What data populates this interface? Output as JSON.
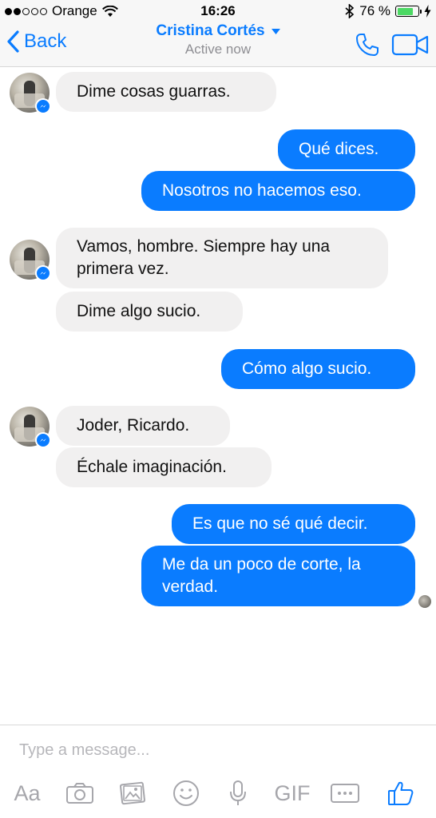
{
  "status_bar": {
    "carrier": "Orange",
    "time": "16:26",
    "battery_percent": "76 %",
    "battery_level": 0.76
  },
  "header": {
    "back_label": "Back",
    "contact_name": "Cristina Cortés",
    "status": "Active now"
  },
  "messages": [
    {
      "side": "in",
      "text": "Dime cosas guarras."
    },
    {
      "side": "out",
      "text": "Qué dices."
    },
    {
      "side": "out",
      "text": "Nosotros no hacemos eso."
    },
    {
      "side": "in",
      "text": "Vamos, hombre. Siempre hay una primera vez."
    },
    {
      "side": "in",
      "text": "Dime algo sucio."
    },
    {
      "side": "out",
      "text": "Cómo algo sucio."
    },
    {
      "side": "in",
      "text": "Joder, Ricardo."
    },
    {
      "side": "in",
      "text": "Échale imaginación."
    },
    {
      "side": "out",
      "text": "Es que no sé qué decir."
    },
    {
      "side": "out",
      "text": "Me da un poco de corte, la verdad."
    }
  ],
  "composer": {
    "placeholder": "Type a message...",
    "tools": {
      "text": "Aa",
      "camera": "camera-icon",
      "gallery": "gallery-icon",
      "emoji": "emoji-icon",
      "mic": "microphone-icon",
      "gif": "GIF",
      "more": "more-icon",
      "like": "thumbs-up-icon"
    }
  },
  "colors": {
    "accent": "#0a7cff",
    "incoming_bubble": "#f1f0f0",
    "outgoing_bubble": "#0a7cff",
    "toolbar_icon": "#a6a6ab"
  }
}
